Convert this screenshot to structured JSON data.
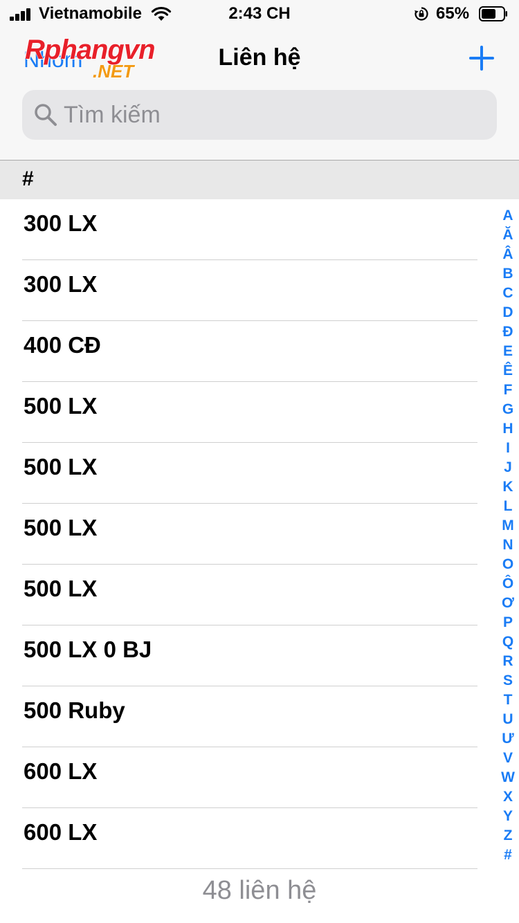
{
  "status_bar": {
    "carrier": "Vietnamobile",
    "time": "2:43 CH",
    "battery_percent": "65%",
    "icons": [
      "signal-icon",
      "wifi-icon",
      "rotation-lock-icon",
      "battery-icon"
    ]
  },
  "header": {
    "back_label": "Nhóm",
    "title": "Liên hệ",
    "add_icon": "plus-icon",
    "watermark_main": "Rphangvn",
    "watermark_sub": ".NET"
  },
  "search": {
    "placeholder": "Tìm kiếm",
    "value": "",
    "icon": "search-icon"
  },
  "section": {
    "label": "#"
  },
  "contacts": [
    "300 LX",
    "300 LX",
    "400 CĐ",
    "500 LX",
    "500 LX",
    "500 LX",
    "500 LX",
    "500 LX 0 BJ",
    "500 Ruby",
    "600 LX",
    "600 LX"
  ],
  "alphabet_index": [
    "A",
    "Ă",
    "Â",
    "B",
    "C",
    "D",
    "Đ",
    "E",
    "Ê",
    "F",
    "G",
    "H",
    "I",
    "J",
    "K",
    "L",
    "M",
    "N",
    "O",
    "Ô",
    "Ơ",
    "P",
    "Q",
    "R",
    "S",
    "T",
    "U",
    "Ư",
    "V",
    "W",
    "X",
    "Y",
    "Z",
    "#"
  ],
  "footer": {
    "count_label": "48 liên hệ"
  },
  "colors": {
    "accent": "#1a7cf5",
    "header_bg": "#f7f7f7",
    "section_bg": "#e8e8e8",
    "search_bg": "#e6e6e8",
    "muted_text": "#8e8e93"
  }
}
